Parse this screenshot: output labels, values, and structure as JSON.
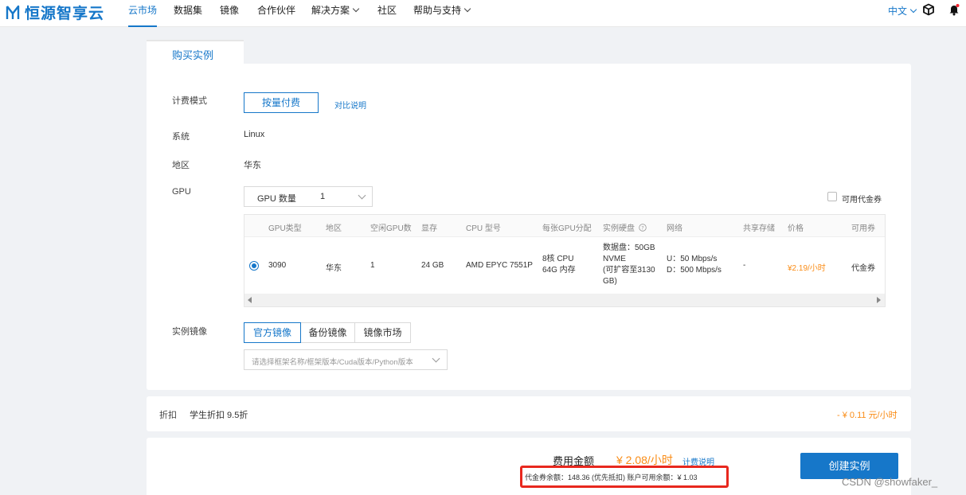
{
  "nav": {
    "logo_text": "恒源智享云",
    "items": [
      "云市场",
      "数据集",
      "镜像",
      "合作伙伴",
      "解决方案",
      "社区",
      "帮助与支持"
    ],
    "lang": "中文"
  },
  "tab": {
    "label": "购买实例"
  },
  "billing": {
    "label": "计费模式",
    "mode": "按量付费",
    "compare_link": "对比说明"
  },
  "system": {
    "label": "系统",
    "value": "Linux"
  },
  "region": {
    "label": "地区",
    "value": "华东"
  },
  "gpu": {
    "label": "GPU",
    "count_label": "GPU 数量",
    "count_value": "1",
    "voucher_label": "可用代金券"
  },
  "table": {
    "headers": [
      "GPU类型",
      "地区",
      "空闲GPU数",
      "显存",
      "CPU 型号",
      "每张GPU分配",
      "实例硬盘",
      "网络",
      "共享存储",
      "价格",
      "可用券"
    ],
    "row": {
      "gpu_type": "3090",
      "region": "华东",
      "free": "1",
      "vram": "24 GB",
      "cpu_model": "AMD EPYC 7551P",
      "alloc_1": "8核 CPU",
      "alloc_2": "64G 内存",
      "disk_1": "数据盘：50GB",
      "disk_2": "NVME",
      "disk_3": "(可扩容至3130",
      "disk_4": "GB)",
      "net_1": "U：50 Mbps/s",
      "net_2": "D：500 Mbps/s",
      "shared": "-",
      "price": "¥2.19/小时",
      "voucher": "代金券"
    }
  },
  "image": {
    "label": "实例镜像",
    "tabs": [
      "官方镜像",
      "备份镜像",
      "镜像市场"
    ],
    "placeholder": "请选择框架名称/框架版本/Cuda版本/Python版本"
  },
  "discount": {
    "label": "折扣",
    "text": "学生折扣 9.5折",
    "amount": "- ¥ 0.11 元/小时"
  },
  "cost": {
    "label": "费用金额",
    "amount": "¥ 2.08/小时",
    "link": "计费说明",
    "detail": "代金券余额：148.36 (优先抵扣)  账户可用余额：¥ 1.03"
  },
  "create_button": "创建实例",
  "watermark": "CSDN @showfaker_",
  "colors": {
    "primary": "#1677c9",
    "orange": "#fa8c16",
    "highlight": "#e8281e"
  }
}
